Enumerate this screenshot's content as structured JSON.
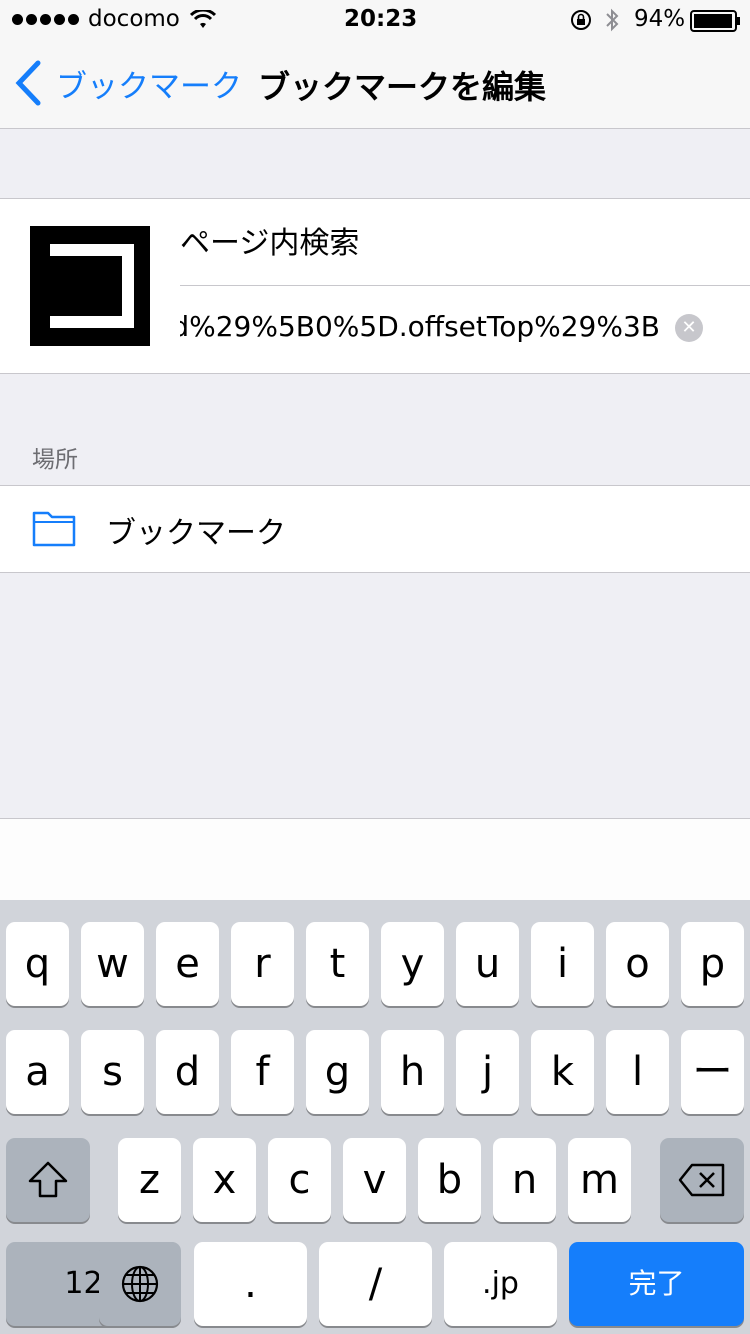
{
  "status": {
    "carrier": "docomo",
    "time": "20:23",
    "battery": "94%"
  },
  "nav": {
    "back_label": "ブックマーク",
    "title": "ブックマークを編集"
  },
  "bookmark": {
    "title": "ページ内検索",
    "url": "d%29%5B0%5D.offsetTop%29%3B",
    "clear_icon": "✕"
  },
  "location": {
    "header": "場所",
    "folder": "ブックマーク"
  },
  "keyboard": {
    "row1": [
      "q",
      "w",
      "e",
      "r",
      "t",
      "y",
      "u",
      "i",
      "o",
      "p"
    ],
    "row2": [
      "a",
      "s",
      "d",
      "f",
      "g",
      "h",
      "j",
      "k",
      "l",
      "ー"
    ],
    "row3": [
      "z",
      "x",
      "c",
      "v",
      "b",
      "n",
      "m"
    ],
    "numbers": "123",
    "dot": ".",
    "slash": "/",
    "jp": ".jp",
    "done": "完了"
  },
  "colors": {
    "accent": "#157efb"
  }
}
